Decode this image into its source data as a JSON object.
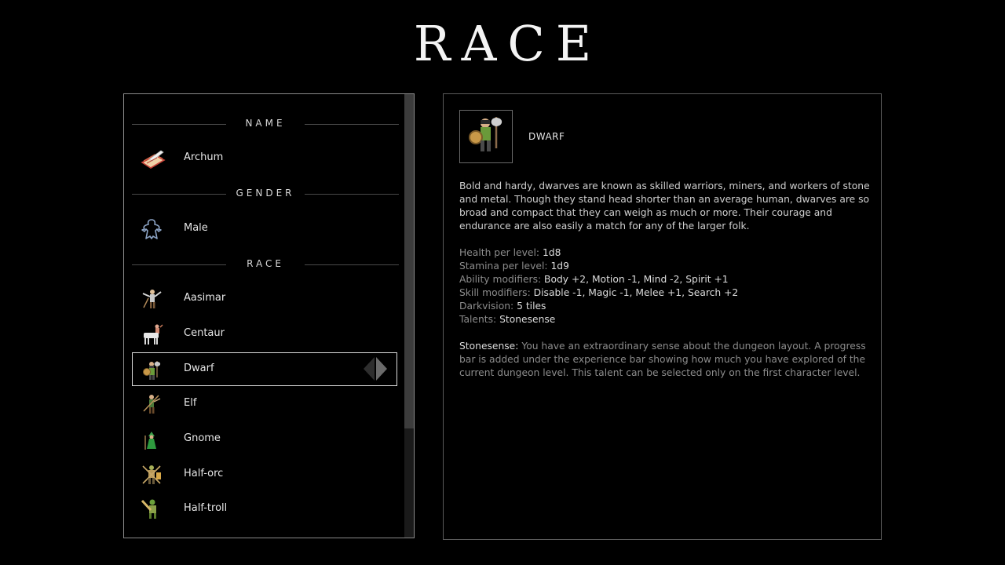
{
  "title": "RACE",
  "left_panel": {
    "name_section": {
      "header": "NAME",
      "value": "Archum"
    },
    "gender_section": {
      "header": "GENDER",
      "value": "Male"
    },
    "race_section": {
      "header": "RACE",
      "items": [
        {
          "label": "Aasimar",
          "icon": "aasimar-sprite-icon"
        },
        {
          "label": "Centaur",
          "icon": "centaur-sprite-icon"
        },
        {
          "label": "Dwarf",
          "icon": "dwarf-sprite-icon",
          "selected": true
        },
        {
          "label": "Elf",
          "icon": "elf-sprite-icon"
        },
        {
          "label": "Gnome",
          "icon": "gnome-sprite-icon"
        },
        {
          "label": "Half-orc",
          "icon": "half-orc-sprite-icon"
        },
        {
          "label": "Half-troll",
          "icon": "half-troll-sprite-icon"
        }
      ]
    }
  },
  "detail": {
    "name": "DWARF",
    "description": "Bold and hardy, dwarves are known as skilled warriors, miners, and workers of stone and metal. Though they stand head shorter than an average human, dwarves are so broad and compact that they can weigh as much or more. Their courage and endurance are also easily a match for any of the larger folk.",
    "stats": [
      {
        "key": "Health per level:",
        "value": "1d8"
      },
      {
        "key": "Stamina per level:",
        "value": "1d9"
      },
      {
        "key": "Ability modifiers:",
        "value": "Body +2, Motion -1, Mind -2, Spirit +1"
      },
      {
        "key": "Skill modifiers:",
        "value": "Disable -1, Magic -1, Melee +1, Search +2"
      },
      {
        "key": "Darkvision:",
        "value": "5 tiles"
      },
      {
        "key": "Talents:",
        "value": "Stonesense"
      }
    ],
    "talent": {
      "name": "Stonesense:",
      "text": "You have an extraordinary sense about the dungeon layout. A progress bar is added under the experience bar showing how much you have explored of the current dungeon level. This talent can be selected only on the first character level."
    }
  }
}
